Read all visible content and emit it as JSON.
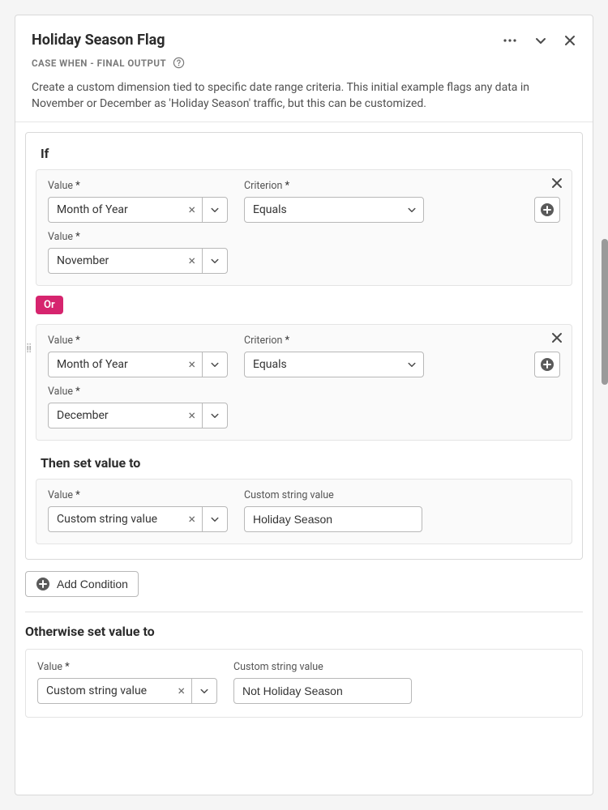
{
  "header": {
    "title": "Holiday Season Flag",
    "subtitle": "CASE WHEN - FINAL OUTPUT",
    "description": "Create a custom dimension tied to specific date range criteria. This initial example flags any data in November or December as 'Holiday Season' traffic, but this can be customized."
  },
  "labels": {
    "if": "If",
    "value": "Value",
    "criterion": "Criterion",
    "then": "Then set value to",
    "custom_string": "Custom string value",
    "or": "Or",
    "add_condition": "Add Condition",
    "otherwise": "Otherwise set value to",
    "asterisk": "*"
  },
  "conditions": [
    {
      "value_dimension": "Month of Year",
      "criterion": "Equals",
      "value_literal": "November"
    },
    {
      "value_dimension": "Month of Year",
      "criterion": "Equals",
      "value_literal": "December"
    }
  ],
  "then": {
    "value_type": "Custom string value",
    "custom_string": "Holiday Season"
  },
  "otherwise": {
    "value_type": "Custom string value",
    "custom_string": "Not Holiday Season"
  }
}
